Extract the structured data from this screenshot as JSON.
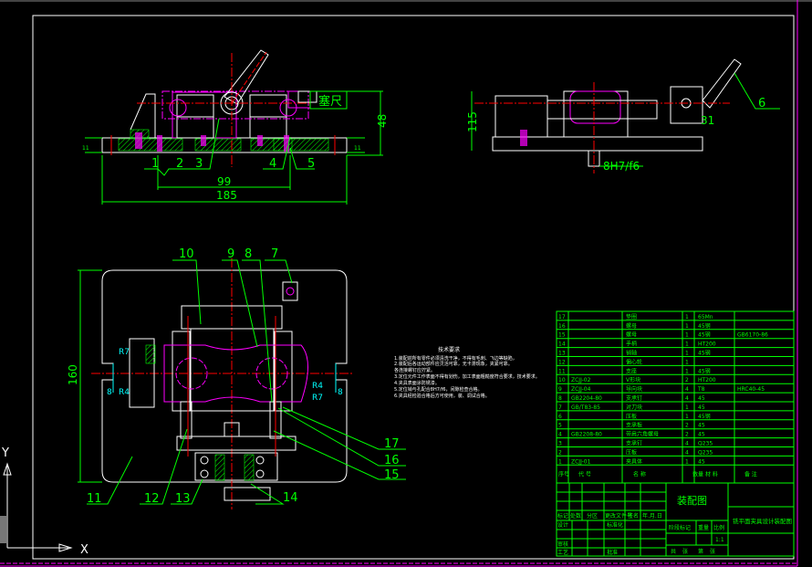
{
  "drawing": {
    "front_view": {
      "labels": [
        "1",
        "2",
        "3",
        "4",
        "5"
      ],
      "dims": {
        "height": "48",
        "span": "99",
        "width": "185",
        "thick_left": "11",
        "thick_right": "11"
      },
      "feeler_gauge": "塞尺"
    },
    "side_view": {
      "label": "6",
      "dims": {
        "height": "115",
        "offset": "31",
        "fit": "8H7/f6"
      }
    },
    "plan_view": {
      "labels": [
        "7",
        "8",
        "9",
        "10",
        "11",
        "12",
        "13",
        "14",
        "15",
        "16",
        "17"
      ],
      "dims": {
        "height": "160",
        "slot_left": "8",
        "slot_right": "8",
        "r_left_top": "R7",
        "r_left_bottom": "R4",
        "r_right_top": "R4",
        "r_right_bottom": "R7"
      }
    },
    "tech_requirements": {
      "title": "技术要求",
      "lines": [
        "1.装配前所有零件必须清洗干净，不得有毛刺、飞边等缺陷，",
        "2.装配后各运动部件应灵活可靠，无卡滞现象，夹紧可靠。",
        "各连接螺钉应拧紧。",
        "3.定位元件工作表面不得有划伤，加工表面粗糙度符合要求，技术要求。",
        "4.夹具表面涂防锈漆。",
        "5.定位销与孔配合8H7/f6，间隙检查合格。",
        "6.夹具经检验合格后方可使用，装、调试合格。"
      ]
    },
    "bom": {
      "rows": [
        {
          "no": "17",
          "code": "",
          "name": "垫圈",
          "qty": "1",
          "material": "65Mn",
          "remark": ""
        },
        {
          "no": "16",
          "code": "",
          "name": "螺母",
          "qty": "1",
          "material": "45钢",
          "remark": ""
        },
        {
          "no": "15",
          "code": "",
          "name": "螺母",
          "qty": "1",
          "material": "45钢",
          "remark": "GB6170-86"
        },
        {
          "no": "14",
          "code": "",
          "name": "手柄",
          "qty": "1",
          "material": "HT200",
          "remark": ""
        },
        {
          "no": "13",
          "code": "",
          "name": "销轴",
          "qty": "1",
          "material": "45钢",
          "remark": ""
        },
        {
          "no": "12",
          "code": "",
          "name": "偏心轮",
          "qty": "1",
          "material": "",
          "remark": ""
        },
        {
          "no": "11",
          "code": "",
          "name": "支座",
          "qty": "1",
          "material": "45钢",
          "remark": ""
        },
        {
          "no": "10",
          "code": "ZCJJ-02",
          "name": "V形块",
          "qty": "2",
          "material": "HT200",
          "remark": ""
        },
        {
          "no": "9",
          "code": "ZCJJ-04",
          "name": "导向块",
          "qty": "4",
          "material": "T8",
          "remark": "HRC40-45"
        },
        {
          "no": "8",
          "code": "GB2204-80",
          "name": "支承钉",
          "qty": "4",
          "material": "45",
          "remark": ""
        },
        {
          "no": "7",
          "code": "GB/T83-85",
          "name": "对刀块",
          "qty": "1",
          "material": "45",
          "remark": ""
        },
        {
          "no": "6",
          "code": "",
          "name": "压板",
          "qty": "1",
          "material": "45钢",
          "remark": ""
        },
        {
          "no": "5",
          "code": "",
          "name": "支承板",
          "qty": "2",
          "material": "45",
          "remark": ""
        },
        {
          "no": "4",
          "code": "GB2208-80",
          "name": "带肩六角螺母",
          "qty": "2",
          "material": "45",
          "remark": ""
        },
        {
          "no": "3",
          "code": "",
          "name": "支承钉",
          "qty": "4",
          "material": "Q235",
          "remark": ""
        },
        {
          "no": "2",
          "code": "",
          "name": "压板",
          "qty": "4",
          "material": "Q235",
          "remark": ""
        },
        {
          "no": "1",
          "code": "ZCJJ-01",
          "name": "夹具体",
          "qty": "1",
          "material": "45",
          "remark": ""
        }
      ],
      "header": {
        "no": "序号",
        "code": "代 号",
        "name": "名 称",
        "qty": "数量",
        "material": "材 料",
        "remark": "备 注"
      }
    },
    "title_block": {
      "drawing_type": "装配图",
      "drawing_name": "铣平面夹具设计装配图",
      "change_row": [
        "标记",
        "处数",
        "分区",
        "更改文件号",
        "签名",
        "年.月.日"
      ],
      "left_rows": [
        "设计",
        "",
        "审核",
        "工艺"
      ],
      "mid_rows": [
        "标准化",
        "",
        "",
        "批准"
      ],
      "stage_mark": "阶段标记",
      "weight": "重量",
      "scale_label": "比例",
      "scale": "1:1",
      "sheets": [
        "共",
        "张",
        "第",
        "张"
      ]
    },
    "ucs": {
      "x": "X",
      "y": "Y"
    }
  },
  "colors": {
    "background": "#000000",
    "outline": "#ffffff",
    "dimension": "#00ff00",
    "center": "#ff0000",
    "phantom": "#ff00ff",
    "radius": "#00ffff"
  }
}
